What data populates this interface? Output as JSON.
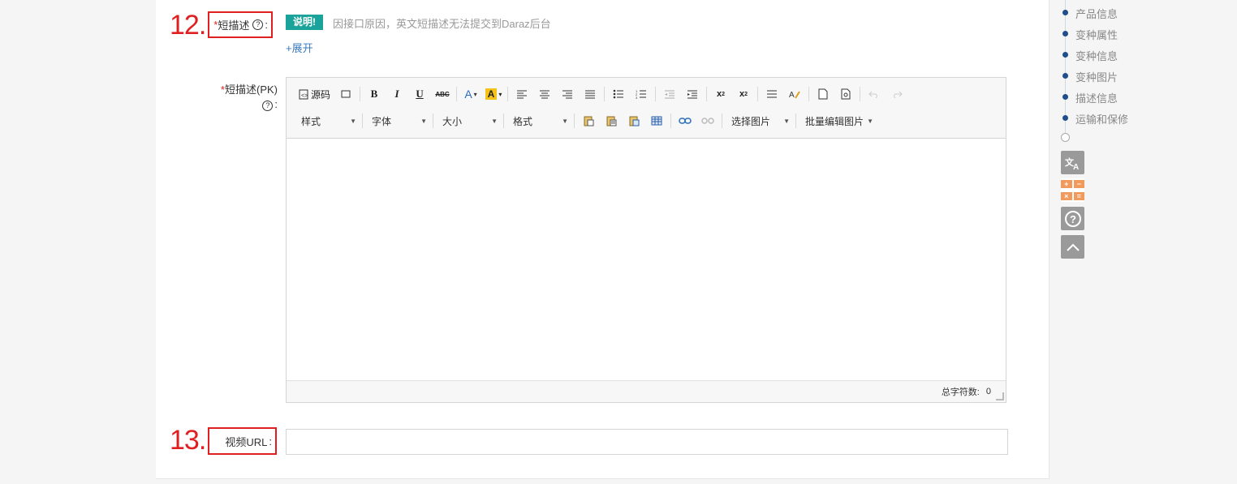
{
  "step12": {
    "num": "12.",
    "label_req": "*",
    "label": "短描述",
    "colon": ":",
    "tag": "说明!",
    "note": "因接口原因，英文短描述无法提交到Daraz后台",
    "expand": "+展开"
  },
  "pk": {
    "label_req": "*",
    "label": "短描述(PK)",
    "colon": ":"
  },
  "editor": {
    "source_label": "源码",
    "combos": {
      "style": "样式",
      "font": "字体",
      "size": "大小",
      "format": "格式",
      "select_image": "选择图片",
      "batch_edit_image": "批量编辑图片"
    },
    "status_label": "总字符数:",
    "char_count": "0"
  },
  "step13": {
    "num": "13.",
    "label": "视频URL",
    "colon": ":",
    "value": ""
  },
  "side_nav": {
    "items": [
      "产品信息",
      "变种属性",
      "变种信息",
      "变种图片",
      "描述信息",
      "运输和保修"
    ]
  },
  "tools": {
    "translate": "translate-icon",
    "calculator": "calculator-icon",
    "help": "help-icon",
    "top": "back-to-top-icon"
  },
  "colors": {
    "accent_red": "#e02020",
    "tag_teal": "#1aa39a",
    "link_blue": "#3a7bbf",
    "nav_dot": "#1f4e8c",
    "calc_orange": "#f29a5c"
  }
}
